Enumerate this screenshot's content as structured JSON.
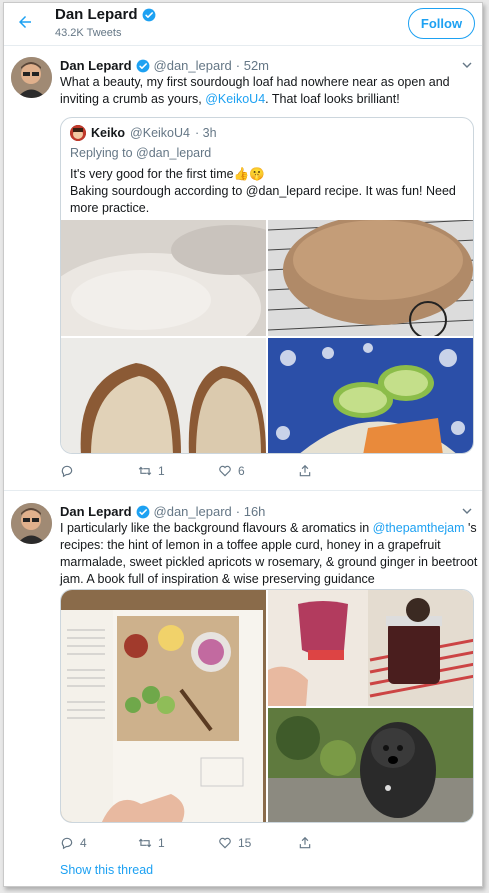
{
  "header": {
    "name": "Dan Lepard",
    "tweet_count": "43.2K Tweets",
    "follow_label": "Follow"
  },
  "tweet1": {
    "name": "Dan Lepard",
    "handle": "@dan_lepard",
    "time": "· 52m",
    "text_before": "What a beauty, my first sourdough loaf had nowhere near as open and inviting a crumb as yours, ",
    "mention": "@KeikoU4",
    "text_after": ". That loaf looks brilliant!",
    "quote": {
      "name": "Keiko",
      "handle": "@KeikoU4",
      "time": "· 3h",
      "replying_to": "Replying to @dan_lepard",
      "line1": "It's very good for the first time👍🤫",
      "line2": "Baking sourdough according to @dan_lepard recipe. It was fun! Need more practice."
    },
    "actions": {
      "reply": "",
      "retweet": "1",
      "like": "6"
    }
  },
  "tweet2": {
    "name": "Dan Lepard",
    "handle": "@dan_lepard",
    "time": "· 16h",
    "text_before": "I particularly like the background flavours & aromatics in ",
    "mention": "@thepamthejam",
    "text_after": " 's recipes: the hint of lemon in a toffee apple curd, honey in a grapefruit marmalade, sweet pickled apricots w rosemary, & ground ginger in beetroot jam. A book full of inspiration & wise preserving guidance",
    "actions": {
      "reply": "4",
      "retweet": "1",
      "like": "15"
    }
  },
  "show_thread": "Show this thread",
  "colors": {
    "accent": "#1da1f2",
    "text": "#14171a",
    "muted": "#657786",
    "border": "#e6ecf0"
  }
}
